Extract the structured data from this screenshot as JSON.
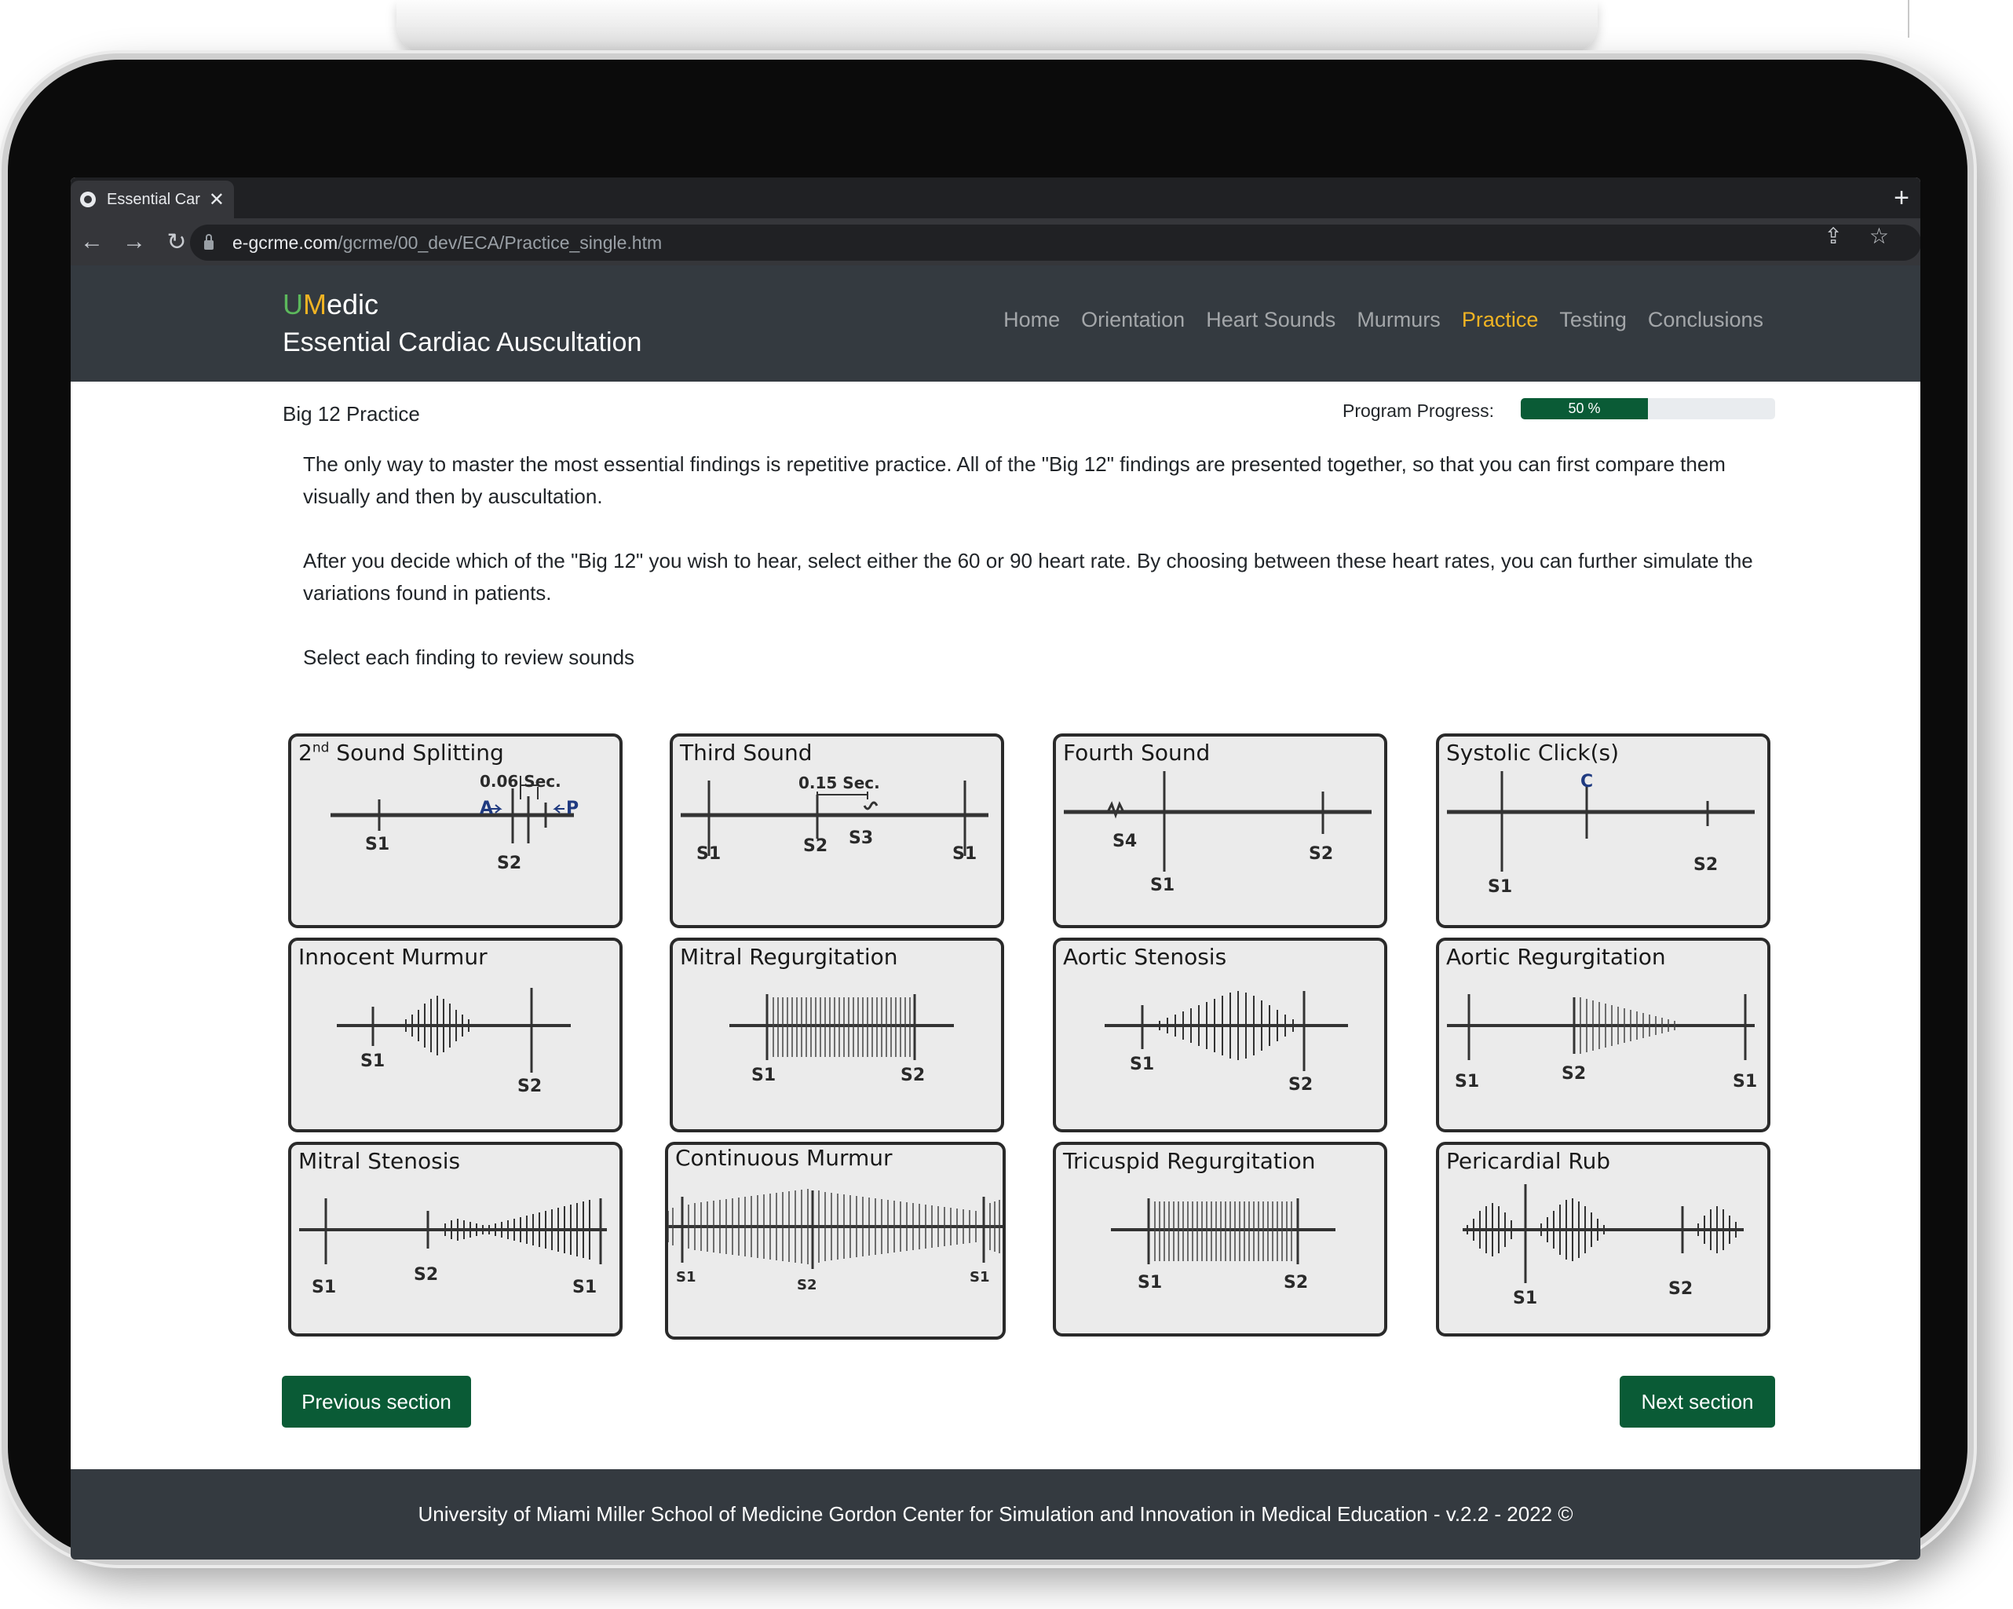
{
  "browser": {
    "tab_title": "Essential Car",
    "url_host": "e-gcrme.com",
    "url_path": "/gcrme/00_dev/ECA/Practice_single.htm"
  },
  "header": {
    "logo_u": "U",
    "logo_m": "M",
    "logo_rest": "edic",
    "subtitle": "Essential Cardiac Auscultation",
    "nav": [
      {
        "label": "Home",
        "active": false
      },
      {
        "label": "Orientation",
        "active": false
      },
      {
        "label": "Heart Sounds",
        "active": false
      },
      {
        "label": "Murmurs",
        "active": false
      },
      {
        "label": "Practice",
        "active": true
      },
      {
        "label": "Testing",
        "active": false
      },
      {
        "label": "Conclusions",
        "active": false
      }
    ]
  },
  "page": {
    "title": "Big 12 Practice",
    "progress_label": "Program Progress:",
    "progress_value": 50,
    "progress_text": "50 %",
    "intro": [
      "The only way to master the most essential findings is repetitive practice. All of the \"Big 12\" findings are presented together, so that you can first compare them visually and then by auscultation.",
      "After you decide which of the \"Big 12\" you wish to hear, select either the 60 or 90 heart rate. By choosing between these heart rates, you can further simulate the variations found in patients.",
      "Select each finding to review sounds"
    ]
  },
  "findings": [
    {
      "title_pre": "2",
      "title_sup": "nd",
      "title": " Sound Splitting",
      "labels": {
        "s1": "S1",
        "s2": "S2",
        "a": "A",
        "p": "P",
        "time": "0.06 Sec."
      }
    },
    {
      "title": "Third Sound",
      "labels": {
        "s1a": "S1",
        "s2": "S2",
        "s3": "S3",
        "s1b": "S1",
        "time": "0.15 Sec."
      }
    },
    {
      "title": "Fourth Sound",
      "labels": {
        "s4": "S4",
        "s1": "S1",
        "s2": "S2"
      }
    },
    {
      "title": "Systolic Click(s)",
      "labels": {
        "c": "C",
        "s1": "S1",
        "s2": "S2"
      }
    },
    {
      "title": "Innocent Murmur",
      "labels": {
        "s1": "S1",
        "s2": "S2"
      }
    },
    {
      "title": "Mitral Regurgitation",
      "labels": {
        "s1": "S1",
        "s2": "S2"
      }
    },
    {
      "title": "Aortic Stenosis",
      "labels": {
        "s1": "S1",
        "s2": "S2"
      }
    },
    {
      "title": "Aortic Regurgitation",
      "labels": {
        "s1a": "S1",
        "s2": "S2",
        "s1b": "S1"
      }
    },
    {
      "title": "Mitral Stenosis",
      "labels": {
        "s1a": "S1",
        "s2": "S2",
        "s1b": "S1"
      }
    },
    {
      "title": "Continuous Murmur",
      "labels": {
        "s1a": "S1",
        "s2": "S2",
        "s1b": "S1"
      }
    },
    {
      "title": "Tricuspid Regurgitation",
      "labels": {
        "s1": "S1",
        "s2": "S2"
      }
    },
    {
      "title": "Pericardial Rub",
      "labels": {
        "s1": "S1",
        "s2": "S2"
      }
    }
  ],
  "buttons": {
    "previous": "Previous section",
    "next": "Next section"
  },
  "footer": "University of Miami Miller School of Medicine Gordon Center for Simulation and Innovation in Medical Education - v.2.2 - 2022 ©"
}
